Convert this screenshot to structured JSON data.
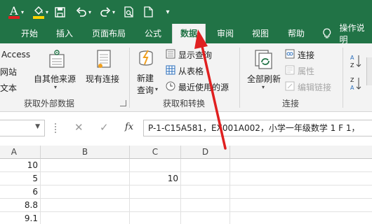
{
  "qat": {
    "font_color_icon": "font-color-icon",
    "fill_color_icon": "fill-color-icon",
    "save_icon": "save-icon",
    "undo_icon": "undo-icon",
    "redo_icon": "redo-icon",
    "print_preview_icon": "print-preview-icon",
    "new_file_icon": "new-file-icon",
    "customize_icon": "customize-qat-icon",
    "font_letter": "A"
  },
  "tabs": [
    {
      "label": "开始"
    },
    {
      "label": "插入"
    },
    {
      "label": "页面布局"
    },
    {
      "label": "公式"
    },
    {
      "label": "数据",
      "active": true
    },
    {
      "label": "审阅"
    },
    {
      "label": "视图"
    },
    {
      "label": "帮助"
    },
    {
      "label": "操作说明"
    }
  ],
  "ribbon": {
    "get_external": {
      "access": "Access",
      "web": "网站",
      "text": "文本",
      "other_sources": "自其他来源",
      "existing_connections": "现有连接",
      "group_label": "获取外部数据"
    },
    "get_transform": {
      "new_query_line1": "新建",
      "new_query_line2": "查询",
      "show_queries": "显示查询",
      "from_table": "从表格",
      "recent_sources": "最近使用的源",
      "group_label": "获取和转换"
    },
    "connections": {
      "refresh_all": "全部刷新",
      "connections": "连接",
      "properties": "属性",
      "edit_links": "编辑链接",
      "group_label": "连接"
    }
  },
  "formula_bar": {
    "cancel": "✕",
    "enter": "✓",
    "fx": "fx",
    "formula": "P-1-C15A581，EX001A002，小学一年级数学 1 F 1，"
  },
  "grid": {
    "columns": [
      "A",
      "B",
      "C",
      "D"
    ],
    "rows": [
      {
        "a": "10",
        "c": ""
      },
      {
        "a": "5",
        "c": "10"
      },
      {
        "a": "6",
        "c": ""
      },
      {
        "a": "8.8",
        "c": ""
      },
      {
        "a": "9.1",
        "c": ""
      }
    ]
  },
  "colors": {
    "brand_green": "#217346",
    "annotation_red": "#e02020"
  }
}
